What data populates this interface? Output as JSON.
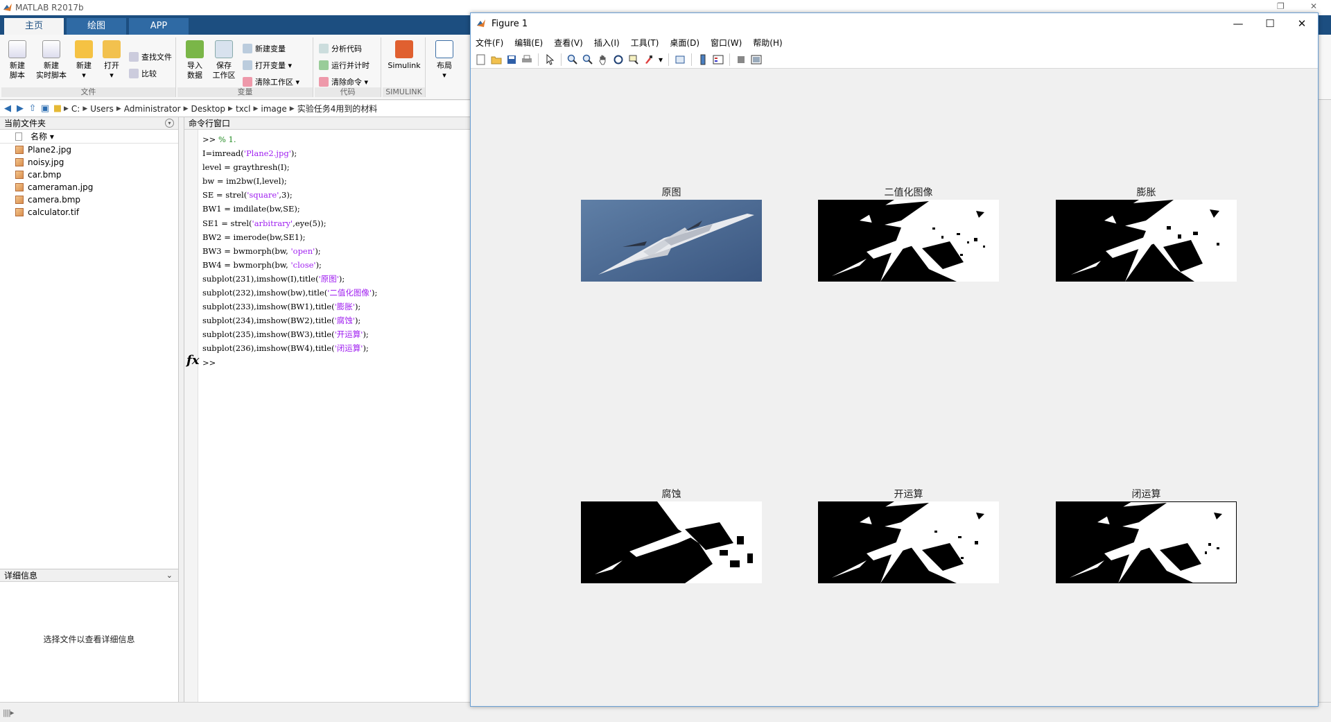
{
  "matlab": {
    "title": "MATLAB R2017b",
    "tabs": [
      "主页",
      "绘图",
      "APP"
    ],
    "ribbon": {
      "file_group": "文件",
      "variable_group": "变量",
      "code_group": "代码",
      "simulink_group": "SIMULINK",
      "new_script": "新建\n脚本",
      "new_live_script": "新建\n实时脚本",
      "new": "新建",
      "open": "打开",
      "find_files": "查找文件",
      "compare": "比较",
      "import_data": "导入\n数据",
      "save_workspace": "保存\n工作区",
      "new_variable": "新建变量",
      "open_variable": "打开变量",
      "clear_workspace": "清除工作区",
      "analyze_code": "分析代码",
      "run_and_time": "运行并计时",
      "clear_commands": "清除命令",
      "simulink": "Simulink",
      "layout": "布局"
    },
    "path": [
      "C:",
      "Users",
      "Administrator",
      "Desktop",
      "txcl",
      "image",
      "实验任务4用到的材料"
    ],
    "current_folder": {
      "header": "当前文件夹",
      "column": "名称",
      "files": [
        "Plane2.jpg",
        "noisy.jpg",
        "car.bmp",
        "cameraman.jpg",
        "camera.bmp",
        "calculator.tif"
      ]
    },
    "details": {
      "header": "详细信息",
      "message": "选择文件以查看详细信息"
    },
    "command_window": {
      "header": "命令行窗口",
      "prompt": ">>"
    }
  },
  "figure": {
    "title": "Figure 1",
    "menus": [
      "文件(F)",
      "编辑(E)",
      "查看(V)",
      "插入(I)",
      "工具(T)",
      "桌面(D)",
      "窗口(W)",
      "帮助(H)"
    ],
    "subplots": [
      {
        "title": "原图",
        "kind": "photo"
      },
      {
        "title": "二值化图像",
        "kind": "binary"
      },
      {
        "title": "膨胀",
        "kind": "dilate"
      },
      {
        "title": "腐蚀",
        "kind": "erode"
      },
      {
        "title": "开运算",
        "kind": "open"
      },
      {
        "title": "闭运算",
        "kind": "close"
      }
    ]
  },
  "colors": {
    "ribbon_tab_bar": "#1c4e80",
    "string_literal": "#a020f0",
    "comment": "#228b22"
  }
}
